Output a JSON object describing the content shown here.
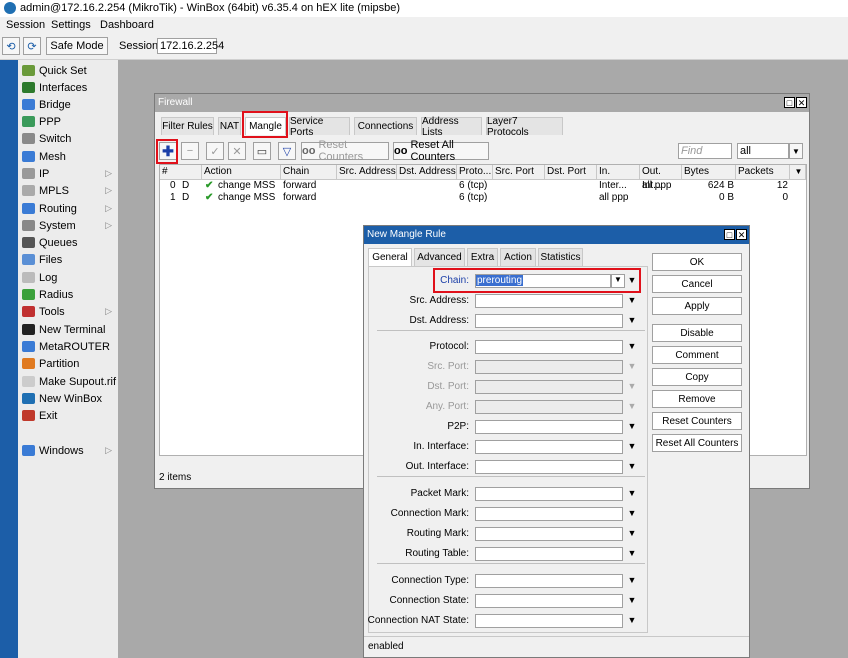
{
  "app": {
    "title": "admin@172.16.2.254 (MikroTik) - WinBox (64bit) v6.35.4 on hEX lite (mipsbe)"
  },
  "menu": [
    "Session",
    "Settings",
    "Dashboard"
  ],
  "toolbar": {
    "safe_mode": "Safe Mode",
    "session_label": "Session:",
    "session_value": "172.16.2.254"
  },
  "nav": [
    {
      "label": "Quick Set",
      "icon": "quick-set-icon",
      "color": "#6a9a3a",
      "arrow": false
    },
    {
      "label": "Interfaces",
      "icon": "interfaces-icon",
      "color": "#2d7a2d",
      "arrow": false
    },
    {
      "label": "Bridge",
      "icon": "bridge-icon",
      "color": "#3a7bd5",
      "arrow": false
    },
    {
      "label": "PPP",
      "icon": "ppp-icon",
      "color": "#3a9a5a",
      "arrow": false
    },
    {
      "label": "Switch",
      "icon": "switch-icon",
      "color": "#8a8a8a",
      "arrow": false
    },
    {
      "label": "Mesh",
      "icon": "mesh-icon",
      "color": "#3a7bd5",
      "arrow": false
    },
    {
      "label": "IP",
      "icon": "ip-icon",
      "color": "#999999",
      "arrow": true
    },
    {
      "label": "MPLS",
      "icon": "mpls-icon",
      "color": "#aaaaaa",
      "arrow": true
    },
    {
      "label": "Routing",
      "icon": "routing-icon",
      "color": "#3a7bd5",
      "arrow": true
    },
    {
      "label": "System",
      "icon": "system-icon",
      "color": "#888888",
      "arrow": true
    },
    {
      "label": "Queues",
      "icon": "queues-icon",
      "color": "#555555",
      "arrow": false
    },
    {
      "label": "Files",
      "icon": "files-icon",
      "color": "#5a8fd5",
      "arrow": false
    },
    {
      "label": "Log",
      "icon": "log-icon",
      "color": "#bbbbbb",
      "arrow": false
    },
    {
      "label": "Radius",
      "icon": "radius-icon",
      "color": "#3aa03a",
      "arrow": false
    },
    {
      "label": "Tools",
      "icon": "tools-icon",
      "color": "#c03030",
      "arrow": true
    },
    {
      "label": "New Terminal",
      "icon": "terminal-icon",
      "color": "#222222",
      "arrow": false
    },
    {
      "label": "MetaROUTER",
      "icon": "metarouter-icon",
      "color": "#3a7bd5",
      "arrow": false
    },
    {
      "label": "Partition",
      "icon": "partition-icon",
      "color": "#e07a20",
      "arrow": false
    },
    {
      "label": "Make Supout.rif",
      "icon": "supout-icon",
      "color": "#cccccc",
      "arrow": false
    },
    {
      "label": "New WinBox",
      "icon": "winbox-icon",
      "color": "#1f6fb2",
      "arrow": false
    },
    {
      "label": "Exit",
      "icon": "exit-icon",
      "color": "#c0392b",
      "arrow": false
    }
  ],
  "nav_windows": {
    "label": "Windows",
    "icon": "windows-icon",
    "color": "#3a7bd5"
  },
  "firewall": {
    "title": "Firewall",
    "tabs": [
      "Filter Rules",
      "NAT",
      "Mangle",
      "Service Ports",
      "Connections",
      "Address Lists",
      "Layer7 Protocols"
    ],
    "active_tab": "Mangle",
    "reset_counters": "Reset Counters",
    "reset_all_counters": "Reset All Counters",
    "find_placeholder": "Find",
    "filter_value": "all",
    "columns": [
      "#",
      "Action",
      "Chain",
      "Src. Address",
      "Dst. Address",
      "Proto...",
      "Src. Port",
      "Dst. Port",
      "In. Inter...",
      "Out. Int...",
      "Bytes",
      "Packets"
    ],
    "rows": [
      {
        "num": "0",
        "flag": "D",
        "action": "change MSS",
        "chain": "forward",
        "src": "",
        "dst": "",
        "proto": "6 (tcp)",
        "sport": "",
        "dport": "",
        "in": "",
        "out": "all ppp",
        "bytes": "624 B",
        "packets": "12"
      },
      {
        "num": "1",
        "flag": "D",
        "action": "change MSS",
        "chain": "forward",
        "src": "",
        "dst": "",
        "proto": "6 (tcp)",
        "sport": "",
        "dport": "",
        "in": "all ppp",
        "out": "",
        "bytes": "0 B",
        "packets": "0"
      }
    ],
    "status": "2 items"
  },
  "mangle_rule": {
    "title": "New Mangle Rule",
    "tabs": [
      "General",
      "Advanced",
      "Extra",
      "Action",
      "Statistics"
    ],
    "active_tab": "General",
    "fields": [
      {
        "label": "Chain:",
        "value": "prerouting",
        "disabled": false
      },
      {
        "label": "Src. Address:",
        "value": "",
        "disabled": false
      },
      {
        "label": "Dst. Address:",
        "value": "",
        "disabled": false
      },
      {
        "label": "Protocol:",
        "value": "",
        "disabled": false
      },
      {
        "label": "Src. Port:",
        "value": "",
        "disabled": true
      },
      {
        "label": "Dst. Port:",
        "value": "",
        "disabled": true
      },
      {
        "label": "Any. Port:",
        "value": "",
        "disabled": true
      },
      {
        "label": "P2P:",
        "value": "",
        "disabled": false
      },
      {
        "label": "In. Interface:",
        "value": "",
        "disabled": false
      },
      {
        "label": "Out. Interface:",
        "value": "",
        "disabled": false
      },
      {
        "label": "Packet Mark:",
        "value": "",
        "disabled": false
      },
      {
        "label": "Connection Mark:",
        "value": "",
        "disabled": false
      },
      {
        "label": "Routing Mark:",
        "value": "",
        "disabled": false
      },
      {
        "label": "Routing Table:",
        "value": "",
        "disabled": false
      },
      {
        "label": "Connection Type:",
        "value": "",
        "disabled": false
      },
      {
        "label": "Connection State:",
        "value": "",
        "disabled": false
      },
      {
        "label": "Connection NAT State:",
        "value": "",
        "disabled": false
      }
    ],
    "buttons": [
      "OK",
      "Cancel",
      "Apply",
      "Disable",
      "Comment",
      "Copy",
      "Remove",
      "Reset Counters",
      "Reset All Counters"
    ],
    "status": "enabled"
  },
  "colors": {
    "accent": "#1c5ea8",
    "highlight": "#e0101a",
    "window_title": "#a9a9a9",
    "dialog_title": "#1c5ea8"
  }
}
